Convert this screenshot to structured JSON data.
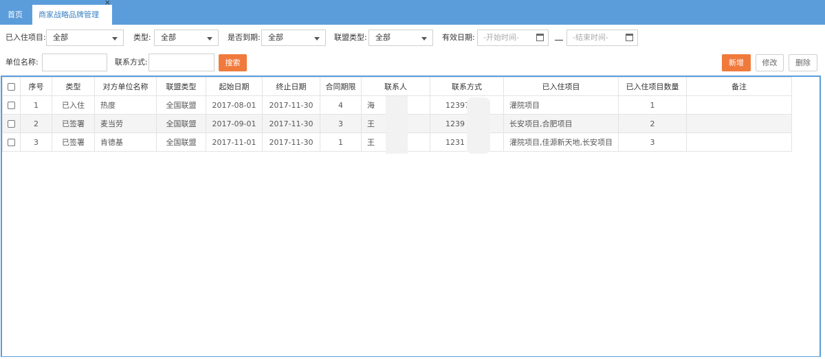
{
  "tabs": [
    {
      "label": "首页"
    },
    {
      "label": "商家战略品牌管理",
      "close": "×"
    }
  ],
  "filters": {
    "project_label": "已入住项目:",
    "project_value": "全部",
    "type_label": "类型:",
    "type_value": "全部",
    "expired_label": "是否到期:",
    "expired_value": "全部",
    "alliance_label": "联盟类型:",
    "alliance_value": "全部",
    "date_label": "有效日期:",
    "date_start_placeholder": "-开始时间-",
    "date_end_placeholder": "-结束时间-",
    "unit_label": "单位名称:",
    "contact_label": "联系方式:",
    "search_button": "搜索"
  },
  "toolbar": {
    "add": "新增",
    "edit": "修改",
    "delete": "删除"
  },
  "table": {
    "headers": [
      "序号",
      "类型",
      "对方单位名称",
      "联盟类型",
      "起始日期",
      "终止日期",
      "合同期限",
      "联系人",
      "联系方式",
      "已入住项目",
      "已入住项目数量",
      "备注"
    ],
    "rows": [
      [
        "1",
        "已入住",
        "热度",
        "全国联盟",
        "2017-08-01",
        "2017-11-30",
        "4",
        "海",
        "12397",
        "灌院项目",
        "1",
        ""
      ],
      [
        "2",
        "已签署",
        "麦当劳",
        "全国联盟",
        "2017-09-01",
        "2017-11-30",
        "3",
        "王",
        "1239",
        "长安项目,合肥项目",
        "2",
        ""
      ],
      [
        "3",
        "已签署",
        "肯德基",
        "全国联盟",
        "2017-11-01",
        "2017-11-30",
        "1",
        "王",
        "1231",
        "灌院项目,佳源新天地,长安项目",
        "3",
        ""
      ]
    ]
  },
  "colors": {
    "header_blue": "#5b9ddb",
    "accent_orange": "#f07a3c"
  }
}
